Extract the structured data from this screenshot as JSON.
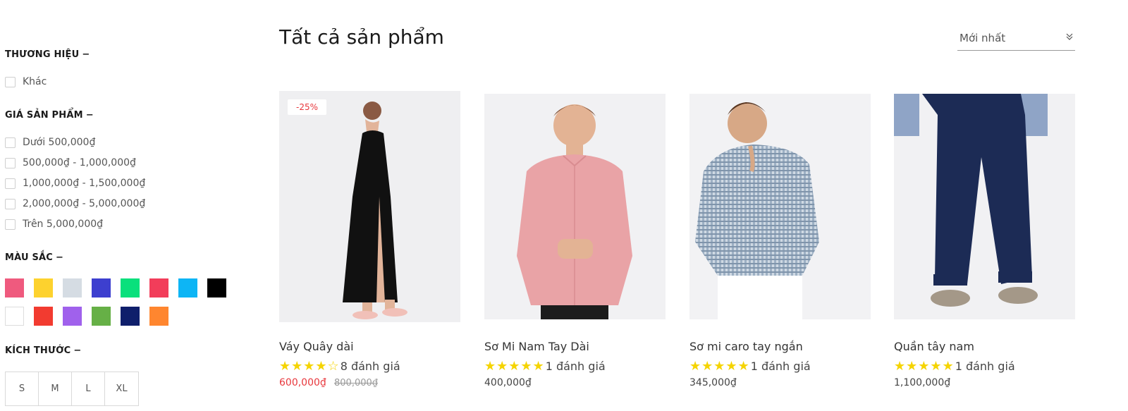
{
  "filters": {
    "brand": {
      "title": "THƯƠNG HIỆU",
      "toggle": "−",
      "options": [
        "Khác"
      ]
    },
    "price": {
      "title": "GIÁ SẢN PHẨM",
      "toggle": "−",
      "options": [
        "Dưới 500,000₫",
        "500,000₫ - 1,000,000₫",
        "1,000,000₫ - 1,500,000₫",
        "2,000,000₫ - 5,000,000₫",
        "Trên 5,000,000₫"
      ]
    },
    "color": {
      "title": "MÀU SẮC",
      "toggle": "−",
      "swatches": [
        "#ef5a7e",
        "#fdd22e",
        "#d5dce3",
        "#3d3fcf",
        "#09e07c",
        "#f23d5a",
        "#0db5f5",
        "#000000",
        "#ffffff",
        "#f23b30",
        "#a061ec",
        "#66b046",
        "#0f1f6b",
        "#ff862f"
      ]
    },
    "size": {
      "title": "KÍCH THƯỚC",
      "toggle": "−",
      "options": [
        "S",
        "M",
        "L",
        "XL"
      ]
    }
  },
  "main": {
    "title": "Tất cả sản phẩm",
    "sort": {
      "selected": "Mới nhất",
      "chevron_icon": "double-chevron-down-icon"
    }
  },
  "products": [
    {
      "name": "Váy Quây dài",
      "discount": "-25%",
      "rating": 4,
      "stars": "★★★★☆",
      "reviews": "8 đánh giá",
      "price": "600,000₫",
      "old_price": "800,000₫"
    },
    {
      "name": "Sơ Mi Nam Tay Dài",
      "rating": 5,
      "stars": "★★★★★",
      "reviews": "1 đánh giá",
      "price": "400,000₫"
    },
    {
      "name": "Sơ mi caro tay ngắn",
      "rating": 5,
      "stars": "★★★★★",
      "reviews": "1 đánh giá",
      "price": "345,000₫"
    },
    {
      "name": "Quần tây nam",
      "rating": 5,
      "stars": "★★★★★",
      "reviews": "1 đánh giá",
      "price": "1,100,000₫"
    }
  ],
  "colors": {
    "star": "#f5d400",
    "sale_price": "#e8383d"
  }
}
